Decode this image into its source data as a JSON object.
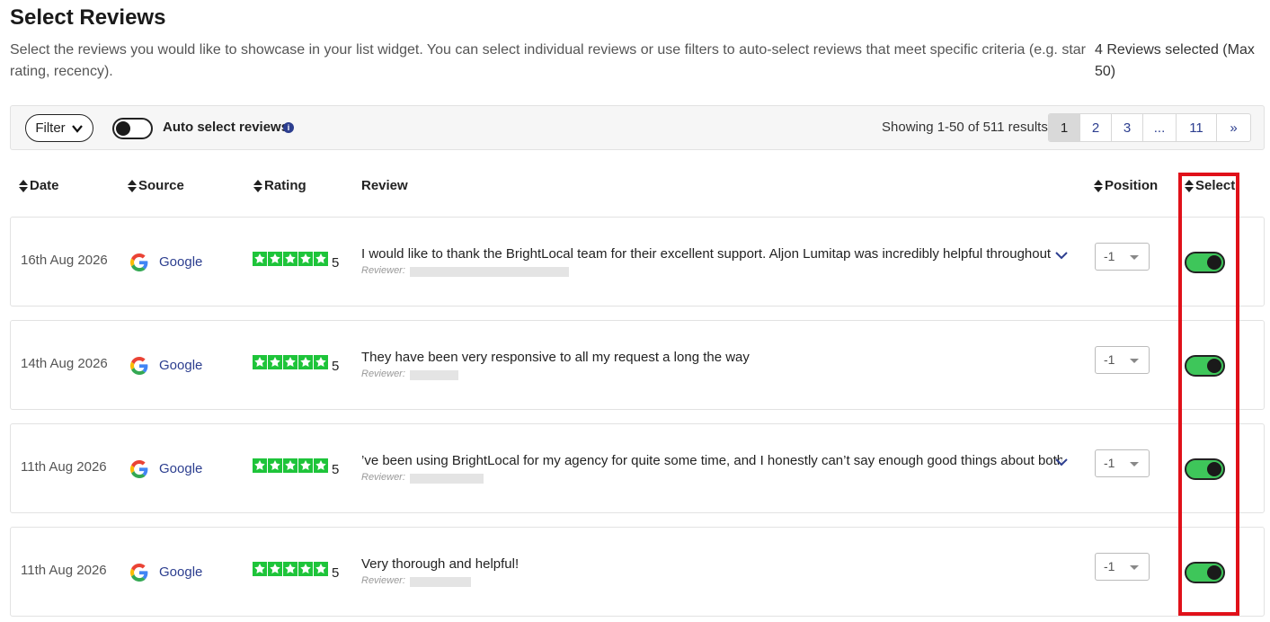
{
  "header": {
    "title": "Select Reviews",
    "intro": "Select the reviews you would like to showcase in your list widget. You can select individual reviews or use filters to auto-select reviews that meet specific criteria (e.g. star rating, recency).",
    "selected_count": "4 Reviews selected (Max 50)"
  },
  "toolbar": {
    "filter_label": "Filter",
    "auto_select_label": "Auto select reviews",
    "info_icon": "i",
    "showing": "Showing 1-50 of 511 results",
    "pages": [
      "1",
      "2",
      "3",
      "...",
      "11",
      "»"
    ],
    "active_page": "1"
  },
  "table": {
    "headers": {
      "date": "Date",
      "source": "Source",
      "rating": "Rating",
      "review": "Review",
      "position": "Position",
      "select": "Select"
    },
    "reviewer_label": "Reviewer:",
    "rows": [
      {
        "date": "16th Aug 2026",
        "source": "Google",
        "rating": "5",
        "review": "I would like to thank the BrightLocal team for their excellent support. Aljon Lumitap was incredibly helpful throughout",
        "expandable": true,
        "position": "-1",
        "selected": true
      },
      {
        "date": "14th Aug 2026",
        "source": "Google",
        "rating": "5",
        "review": "They have been very responsive to all my request a long the way",
        "expandable": false,
        "position": "-1",
        "selected": true
      },
      {
        "date": "11th Aug 2026",
        "source": "Google",
        "rating": "5",
        "review": "’ve been using BrightLocal for my agency for quite some time, and I honestly can’t say enough good things about both",
        "expandable": true,
        "position": "-1",
        "selected": true
      },
      {
        "date": "11th Aug 2026",
        "source": "Google",
        "rating": "5",
        "review": "Very thorough and helpful!",
        "expandable": false,
        "position": "-1",
        "selected": true
      }
    ]
  },
  "colors": {
    "accent": "#2c3e8f",
    "star": "#1ec43a",
    "toggle_on": "#3ec65a",
    "highlight": "#e0111a"
  }
}
